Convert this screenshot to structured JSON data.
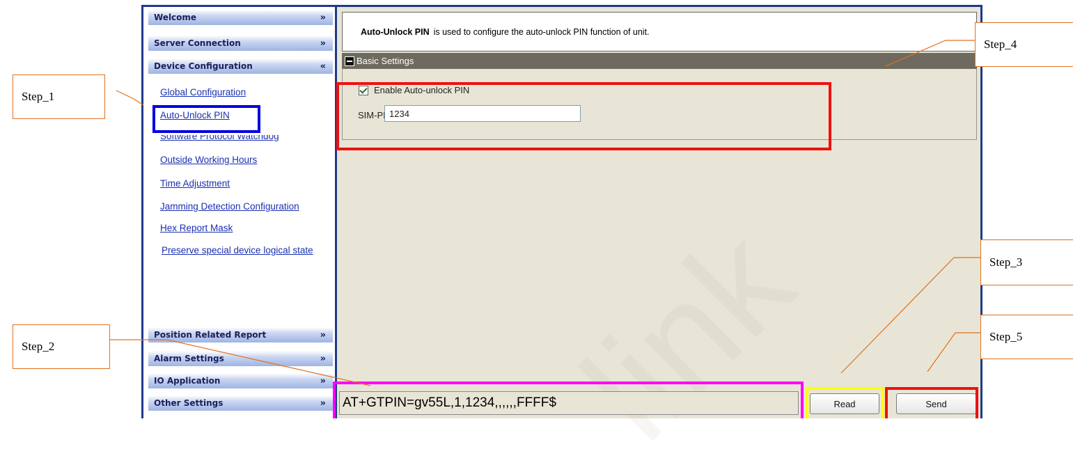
{
  "steps": {
    "step1": "Step_1",
    "step2": "Step_2",
    "step3": "Step_3",
    "step4": "Step_4",
    "step5": "Step_5"
  },
  "sidebar": {
    "headers_top": [
      {
        "label": "Welcome",
        "chevron": "»"
      },
      {
        "label": "Server Connection",
        "chevron": "»"
      },
      {
        "label": "Device Configuration",
        "chevron": "«"
      }
    ],
    "items": [
      {
        "label": "Global Configuration"
      },
      {
        "label": "Auto-Unlock PIN"
      },
      {
        "label": "Software Protocol Watchdog"
      },
      {
        "label": "Outside Working Hours"
      },
      {
        "label": "Time Adjustment"
      },
      {
        "label": "Jamming Detection Configuration"
      },
      {
        "label": "Hex Report Mask"
      },
      {
        "label": "Preserve special device logical state"
      }
    ],
    "headers_bottom": [
      {
        "label": "Position Related Report",
        "chevron": "»"
      },
      {
        "label": "Alarm Settings",
        "chevron": "»"
      },
      {
        "label": "IO Application",
        "chevron": "»"
      },
      {
        "label": "Other Settings",
        "chevron": "»"
      }
    ]
  },
  "main": {
    "desc_title": "Auto-Unlock PIN",
    "desc_text": "is used to configure the auto-unlock PIN function of unit.",
    "section_title": "Basic Settings",
    "enable_label": "Enable Auto-unlock PIN",
    "enable_checked": true,
    "simpin_label": "SIM-PIN:",
    "simpin_value": "1234"
  },
  "watermark": "link",
  "bottom": {
    "command": "AT+GTPIN=gv55L,1,1234,,,,,,FFFF$",
    "read_label": "Read",
    "send_label": "Send"
  },
  "colors": {
    "callout_line": "#E07020",
    "highlight_blue": "#0000E0",
    "highlight_red": "#EE1111",
    "highlight_magenta": "#FF00FF",
    "highlight_yellow": "#FFFF00",
    "frame": "#1E3A8A",
    "panel_bg": "#E9E5D6"
  }
}
